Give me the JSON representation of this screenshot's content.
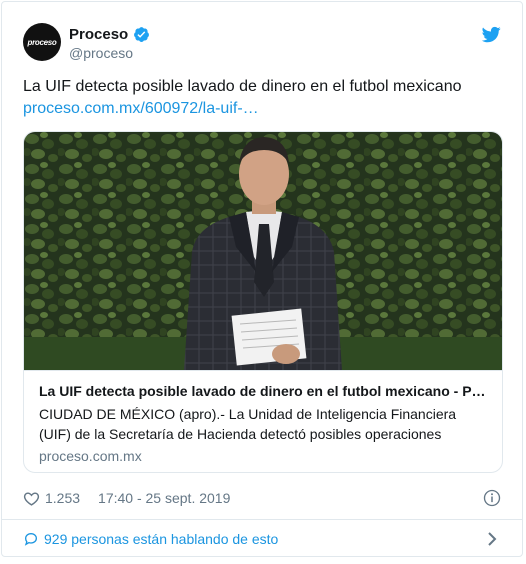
{
  "account": {
    "avatar_text": "proceso",
    "display_name": "Proceso",
    "handle": "@proceso",
    "verified_icon": "verified-badge-icon"
  },
  "tweet": {
    "text": "La UIF detecta posible lavado de dinero en el futbol mexicano",
    "link": "proceso.com.mx/600972/la-uif-…"
  },
  "card": {
    "title": "La UIF detecta posible lavado de dinero en el futbol mexicano - P…",
    "description": "CIUDAD DE MÉXICO (apro).- La Unidad de Inteligencia Financiera (UIF) de la Secretaría de Hacienda detectó posibles operaciones",
    "domain": "proceso.com.mx"
  },
  "meta": {
    "likes": "1.253",
    "timestamp": "17:40 - 25 sept. 2019"
  },
  "conversation": {
    "label": "929 personas están hablando de esto"
  },
  "colors": {
    "link": "#1b95e0",
    "secondary": "#657786",
    "border": "#e1e8ed",
    "verified": "#1da1f2"
  }
}
